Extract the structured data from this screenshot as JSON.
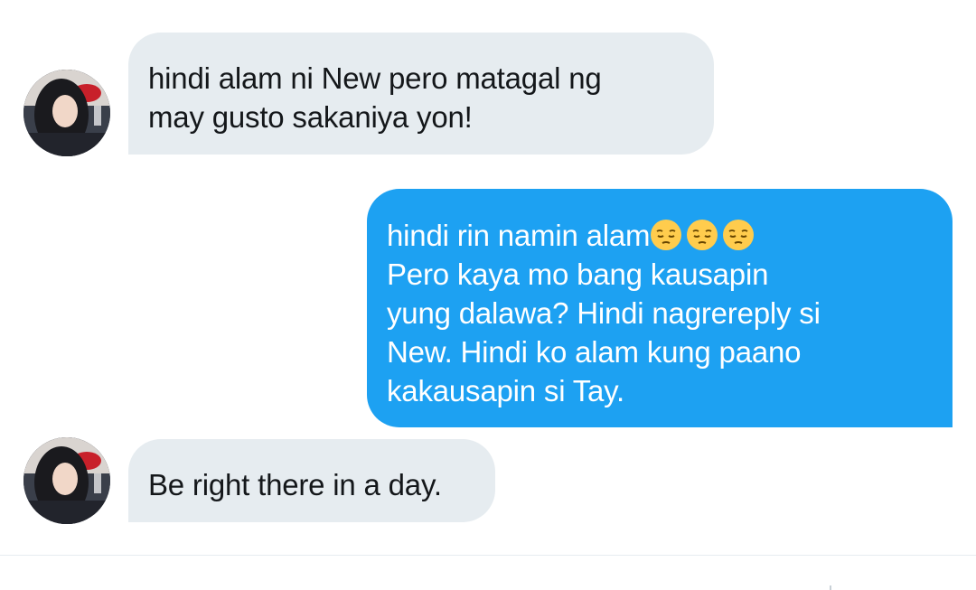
{
  "messages": [
    {
      "direction": "incoming",
      "lines": [
        "hindi alam ni New pero matagal ng",
        "may gusto sakaniya yon!"
      ]
    },
    {
      "direction": "outgoing",
      "first_line_text": "hindi rin namin alam",
      "first_line_emojis": [
        "pensive-face",
        "pensive-face",
        "pensive-face"
      ],
      "lines": [
        "Pero kaya mo bang kausapin",
        "yung dalawa? Hindi nagrereply si",
        "New. Hindi ko alam kung paano",
        "kakausapin si Tay."
      ]
    },
    {
      "direction": "incoming",
      "lines": [
        "Be right there in a day."
      ]
    }
  ],
  "colors": {
    "incoming_bubble": "#e6ecf0",
    "incoming_text": "#14171a",
    "outgoing_bubble": "#1da1f2",
    "outgoing_text": "#ffffff"
  }
}
